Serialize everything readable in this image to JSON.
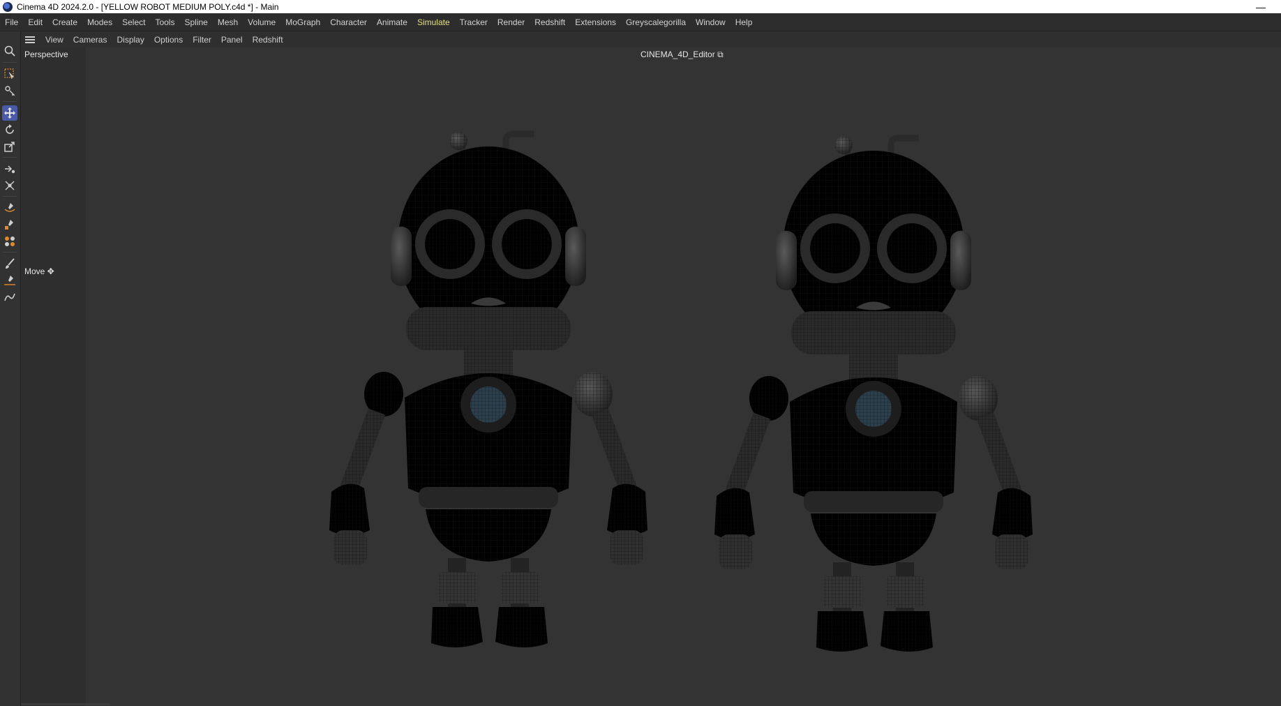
{
  "window": {
    "title": "Cinema 4D 2024.2.0 - [YELLOW ROBOT MEDIUM POLY.c4d *] - Main",
    "minimize_glyph": "—"
  },
  "menubar": {
    "items": [
      "File",
      "Edit",
      "Create",
      "Modes",
      "Select",
      "Tools",
      "Spline",
      "Mesh",
      "Volume",
      "MoGraph",
      "Character",
      "Animate",
      "Simulate",
      "Tracker",
      "Render",
      "Redshift",
      "Extensions",
      "Greyscalegorilla",
      "Window",
      "Help"
    ],
    "active_index": 12,
    "active_color": "#e5e07a"
  },
  "viewbar": {
    "items": [
      "View",
      "Cameras",
      "Display",
      "Options",
      "Filter",
      "Panel",
      "Redshift"
    ]
  },
  "viewport": {
    "name": "Perspective",
    "camera": "CINEMA_4D_Editor",
    "tool_hint": "Move"
  },
  "tools": [
    {
      "icon": "search-icon"
    },
    {
      "icon": "selection-icon"
    },
    {
      "icon": "tweak-icon"
    },
    {
      "icon": "move-icon",
      "active": true
    },
    {
      "icon": "rotate-icon"
    },
    {
      "icon": "scale-icon"
    },
    {
      "icon": "transfer-icon"
    },
    {
      "icon": "snap-icon"
    },
    {
      "icon": "spline-pen-icon"
    },
    {
      "icon": "spline-tool-icon"
    },
    {
      "icon": "mograph-icon"
    },
    {
      "icon": "brush-icon"
    },
    {
      "icon": "sketch-icon"
    },
    {
      "icon": "path-icon"
    }
  ],
  "colors": {
    "robot_white": "#e8e8e8",
    "robot_yellow": "#d4a417",
    "wire": "#1a1a1a",
    "active_tool": "#4a5aa8"
  }
}
